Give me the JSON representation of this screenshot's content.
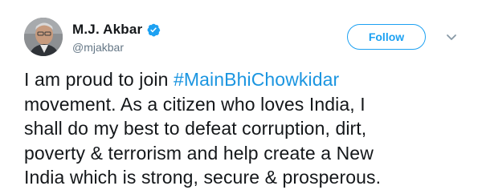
{
  "tweet": {
    "author": {
      "display_name": "M.J. Akbar",
      "handle": "@mjakbar",
      "verified": true
    },
    "follow_label": "Follow",
    "text_lines": [
      {
        "before": "I am proud to join ",
        "hashtag": "#MainBhiChowkidar"
      },
      {
        "text": "movement. As a citizen who loves India, I"
      },
      {
        "text": "shall do my best to defeat corruption, dirt,"
      },
      {
        "text": "poverty & terrorism and help create a New"
      },
      {
        "text": "India which is strong, secure & prosperous."
      }
    ]
  },
  "icons": {
    "verified": "verified-badge-icon",
    "menu": "chevron-down-icon"
  },
  "colors": {
    "accent": "#1da1f2",
    "hashtag": "#1b95e0",
    "text": "#14171a",
    "secondary_text": "#657786"
  }
}
